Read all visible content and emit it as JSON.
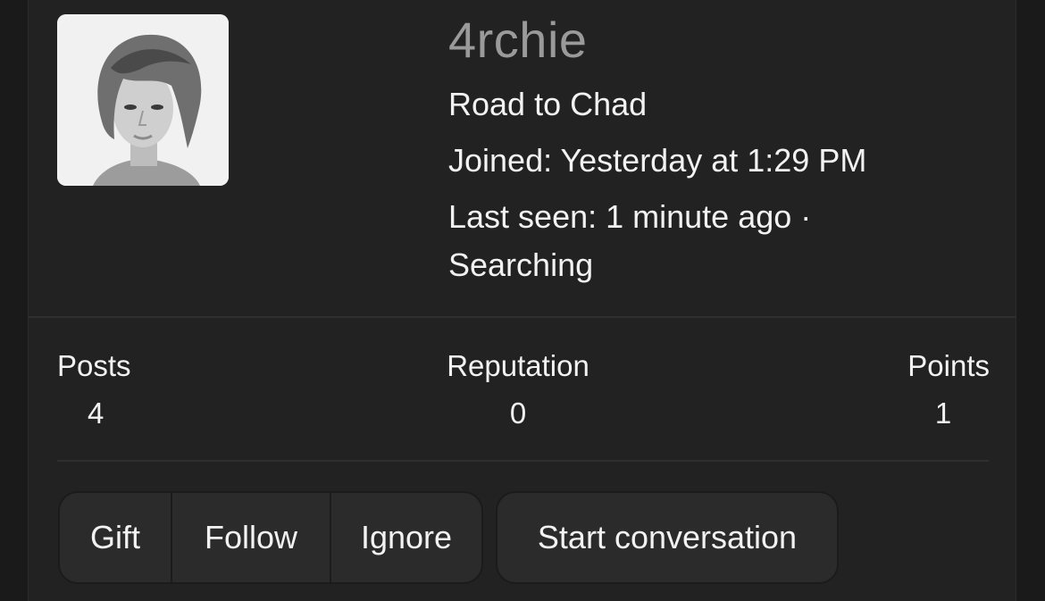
{
  "profile": {
    "username": "4rchie",
    "title": "Road to Chad",
    "joined": "Joined: Yesterday at 1:29 PM",
    "last_seen": "Last seen: 1 minute ago ·",
    "activity": "Searching",
    "avatar_icon": "user-avatar-photo"
  },
  "stats": {
    "posts_label": "Posts",
    "posts_value": "4",
    "reputation_label": "Reputation",
    "reputation_value": "0",
    "points_label": "Points",
    "points_value": "1"
  },
  "actions": {
    "gift": "Gift",
    "follow": "Follow",
    "ignore": "Ignore",
    "start_conversation": "Start conversation"
  },
  "colors": {
    "background": "#1a1a1a",
    "card": "#222222",
    "username": "#9a9a9a",
    "text": "#f2f2f2",
    "button": "#2b2b2b"
  }
}
